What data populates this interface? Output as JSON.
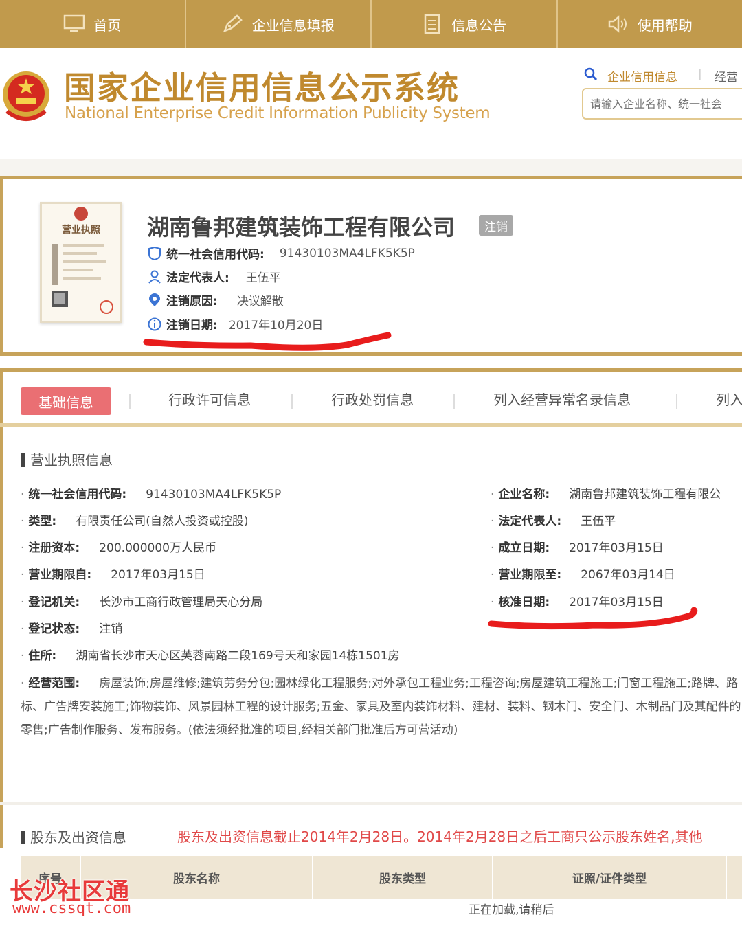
{
  "nav": [
    {
      "label": "首页",
      "icon": "monitor-icon"
    },
    {
      "label": "企业信息填报",
      "icon": "pen-icon"
    },
    {
      "label": "信息公告",
      "icon": "document-icon"
    },
    {
      "label": "使用帮助",
      "icon": "speaker-icon"
    }
  ],
  "header": {
    "title": "国家企业信用信息公示系统",
    "subtitle": "National Enterprise Credit Information Publicity System",
    "search_link": "企业信用信息",
    "search_link2": "经营",
    "search_placeholder": "请输入企业名称、统一社会"
  },
  "company": {
    "name": "湖南鲁邦建筑装饰工程有限公司",
    "status_badge": "注销",
    "fields": [
      {
        "label": "统一社会信用代码:",
        "value": "91430103MA4LFK5K5P",
        "icon": "shield-icon"
      },
      {
        "label": "法定代表人:",
        "value": "王伍平",
        "icon": "person-icon"
      },
      {
        "label": "注销原因:",
        "value": "决议解散",
        "icon": "location-icon"
      },
      {
        "label": "注销日期:",
        "value": "2017年10月20日",
        "icon": "info-icon"
      }
    ]
  },
  "tabs": [
    "基础信息",
    "行政许可信息",
    "行政处罚信息",
    "列入经营异常名录信息",
    "列入"
  ],
  "license_section": {
    "title": "营业执照信息",
    "left": [
      {
        "label": "统一社会信用代码:",
        "value": "91430103MA4LFK5K5P"
      },
      {
        "label": "类型:",
        "value": "有限责任公司(自然人投资或控股)"
      },
      {
        "label": "注册资本:",
        "value": "200.000000万人民币"
      },
      {
        "label": "营业期限自:",
        "value": "2017年03月15日"
      },
      {
        "label": "登记机关:",
        "value": "长沙市工商行政管理局天心分局"
      },
      {
        "label": "登记状态:",
        "value": "注销"
      },
      {
        "label": "住所:",
        "value": "湖南省长沙市天心区芙蓉南路二段169号天和家园14栋1501房"
      }
    ],
    "right": [
      {
        "label": "企业名称:",
        "value": "湖南鲁邦建筑装饰工程有限公"
      },
      {
        "label": "法定代表人:",
        "value": "王伍平"
      },
      {
        "label": "成立日期:",
        "value": "2017年03月15日"
      },
      {
        "label": "营业期限至:",
        "value": "2067年03月14日"
      },
      {
        "label": "核准日期:",
        "value": "2017年03月15日"
      }
    ],
    "scope_label": "经营范围:",
    "scope_value": "房屋装饰;房屋维修;建筑劳务分包;园林绿化工程服务;对外承包工程业务;工程咨询;房屋建筑工程施工;门窗工程施工;路牌、路标、广告牌安装施工;饰物装饰、风景园林工程的设计服务;五金、家具及室内装饰材料、建材、装料、钢木门、安全门、木制品门及其配件的零售;广告制作服务、发布服务。(依法须经批准的项目,经相关部门批准后方可营活动)"
  },
  "shareholder_section": {
    "title": "股东及出资信息",
    "notice": "股东及出资信息截止2014年2月28日。2014年2月28日之后工商只公示股东姓名,其他",
    "columns": [
      "序号",
      "股东名称",
      "股东类型",
      "证照/证件类型"
    ],
    "loading": "正在加载,请稍后"
  },
  "license_image": {
    "title": "营业执照"
  },
  "watermark": {
    "cn": "长沙社区通",
    "url": "www.cssqt.com"
  },
  "colors": {
    "accent": "#c19a4c",
    "active_tab": "#ea6f73",
    "notice": "#e04848",
    "annotation": "#e81c1c"
  }
}
